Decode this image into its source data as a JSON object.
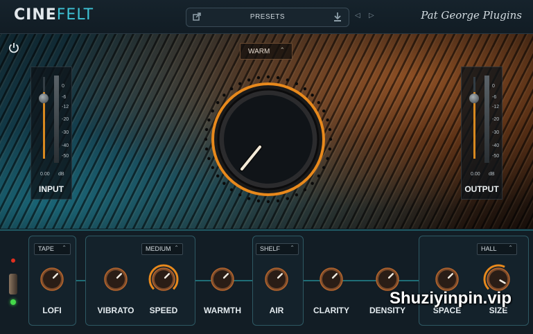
{
  "header": {
    "logo_part1": "CINE",
    "logo_part2": "FELT",
    "presets_label": "PRESETS",
    "brand": "Pat George Plugins"
  },
  "hero": {
    "mode_select": "WARM"
  },
  "input_meter": {
    "label": "INPUT",
    "value": "0.00",
    "unit": "dB",
    "scale": [
      "0",
      "-6",
      "-12",
      "-20",
      "-30",
      "-40",
      "-50"
    ]
  },
  "output_meter": {
    "label": "OUTPUT",
    "value": "0.00",
    "unit": "dB",
    "scale": [
      "0",
      "-6",
      "-12",
      "-20",
      "-30",
      "-40",
      "-50"
    ]
  },
  "modules": {
    "lofi": {
      "select": "TAPE",
      "label": "LOFI"
    },
    "vibrato": {
      "label": "VIBRATO"
    },
    "speed": {
      "select": "MEDIUM",
      "label": "SPEED"
    },
    "warmth": {
      "label": "WARMTH"
    },
    "air": {
      "select": "SHELF",
      "label": "AIR"
    },
    "clarity": {
      "label": "CLARITY"
    },
    "density": {
      "label": "DENSITY"
    },
    "space": {
      "label": "SPACE"
    },
    "size": {
      "select": "HALL",
      "label": "SIZE"
    }
  },
  "watermark": "Shuziyinpin.vip",
  "colors": {
    "accent_orange": "#e8891c",
    "accent_teal": "#3ec3d6"
  },
  "icons": [
    "power-icon",
    "export-icon",
    "download-icon",
    "chevron-left-icon",
    "chevron-right-icon",
    "chevron-down-icon"
  ]
}
